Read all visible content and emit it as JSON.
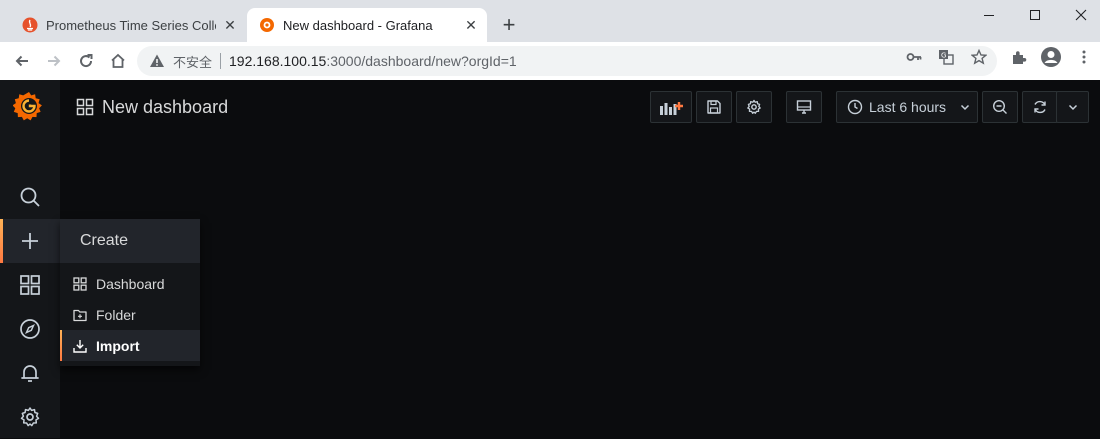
{
  "browser": {
    "tabs": [
      {
        "title": "Prometheus Time Series Collec",
        "active": false
      },
      {
        "title": "New dashboard - Grafana",
        "active": true
      }
    ],
    "address": {
      "security_label": "不安全",
      "host": "192.168.100.15",
      "rest": ":3000/dashboard/new?orgId=1"
    }
  },
  "grafana": {
    "dashboard_title": "New dashboard",
    "time_range": "Last 6 hours",
    "create_menu": {
      "header": "Create",
      "items": [
        {
          "label": "Dashboard",
          "icon": "apps-icon"
        },
        {
          "label": "Folder",
          "icon": "folder-plus-icon"
        },
        {
          "label": "Import",
          "icon": "import-icon"
        }
      ]
    },
    "accent_color": "#ff7941",
    "background_color": "#0b0c0e"
  }
}
